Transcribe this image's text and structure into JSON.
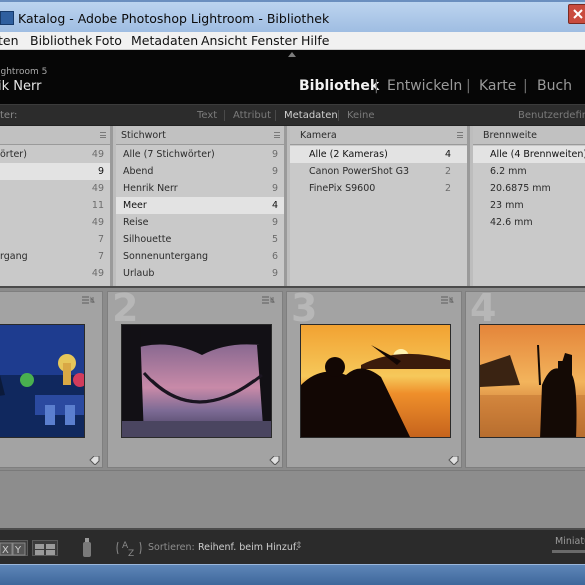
{
  "window": {
    "title": "Katalog - Adobe Photoshop Lightroom - Bibliothek"
  },
  "menubar": [
    "ten",
    "Bibliothek",
    "Foto",
    "Metadaten",
    "Ansicht",
    "Fenster",
    "Hilfe"
  ],
  "identity": {
    "version": "ightroom 5",
    "owner": "ik Nerr"
  },
  "modules": {
    "items": [
      "Bibliothek",
      "Entwickeln",
      "Karte",
      "Buch"
    ],
    "active": "Bibliothek"
  },
  "filter": {
    "label": "ter:",
    "tabs": [
      "Text",
      "Attribut",
      "Metadaten",
      "Keine"
    ],
    "active": "Metadaten",
    "preset": "Benutzerdefini"
  },
  "metadata_browser": {
    "columns": [
      {
        "header": "",
        "rows": [
          {
            "label": "örter)",
            "count": "49"
          },
          {
            "label": "",
            "count": "9",
            "selected": true
          },
          {
            "label": "",
            "count": "49"
          },
          {
            "label": "",
            "count": "11"
          },
          {
            "label": "",
            "count": "49"
          },
          {
            "label": "",
            "count": "7"
          },
          {
            "label": "rgang",
            "count": "7"
          },
          {
            "label": "",
            "count": "49"
          }
        ]
      },
      {
        "header": "Stichwort",
        "rows": [
          {
            "label": "Alle (7 Stichwörter)",
            "count": "9"
          },
          {
            "label": "Abend",
            "count": "9"
          },
          {
            "label": "Henrik Nerr",
            "count": "9"
          },
          {
            "label": "Meer",
            "count": "4",
            "selected": true
          },
          {
            "label": "Reise",
            "count": "9"
          },
          {
            "label": "Silhouette",
            "count": "5"
          },
          {
            "label": "Sonnenuntergang",
            "count": "6"
          },
          {
            "label": "Urlaub",
            "count": "9"
          }
        ]
      },
      {
        "header": "Kamera",
        "rows": [
          {
            "label": "Alle (2 Kameras)",
            "count": "4",
            "selected": true
          },
          {
            "label": "Canon PowerShot G3",
            "count": "2"
          },
          {
            "label": "FinePix S9600",
            "count": "2"
          }
        ]
      },
      {
        "header": "Brennweite",
        "rows": [
          {
            "label": "Alle (4 Brennweiten)",
            "count": "",
            "selected": true
          },
          {
            "label": "6.2 mm",
            "count": ""
          },
          {
            "label": "20.6875 mm",
            "count": ""
          },
          {
            "label": "23 mm",
            "count": ""
          },
          {
            "label": "42.6 mm",
            "count": ""
          }
        ]
      }
    ]
  },
  "grid": {
    "cells": [
      {
        "index": "",
        "scene": "night-harbor"
      },
      {
        "index": "2",
        "scene": "hammock-dusk"
      },
      {
        "index": "3",
        "scene": "sunset-silhouette"
      },
      {
        "index": "4",
        "scene": "photographer-sunset"
      }
    ]
  },
  "toolbar": {
    "sort_label": "Sortieren:",
    "sort_value": "Reihenf. beim Hinzuf.",
    "thumbs_label": "Miniatu"
  },
  "colors": {
    "accent": "#5b86bd",
    "panel": "#c9c9c9",
    "background": "#1b1b1b"
  }
}
